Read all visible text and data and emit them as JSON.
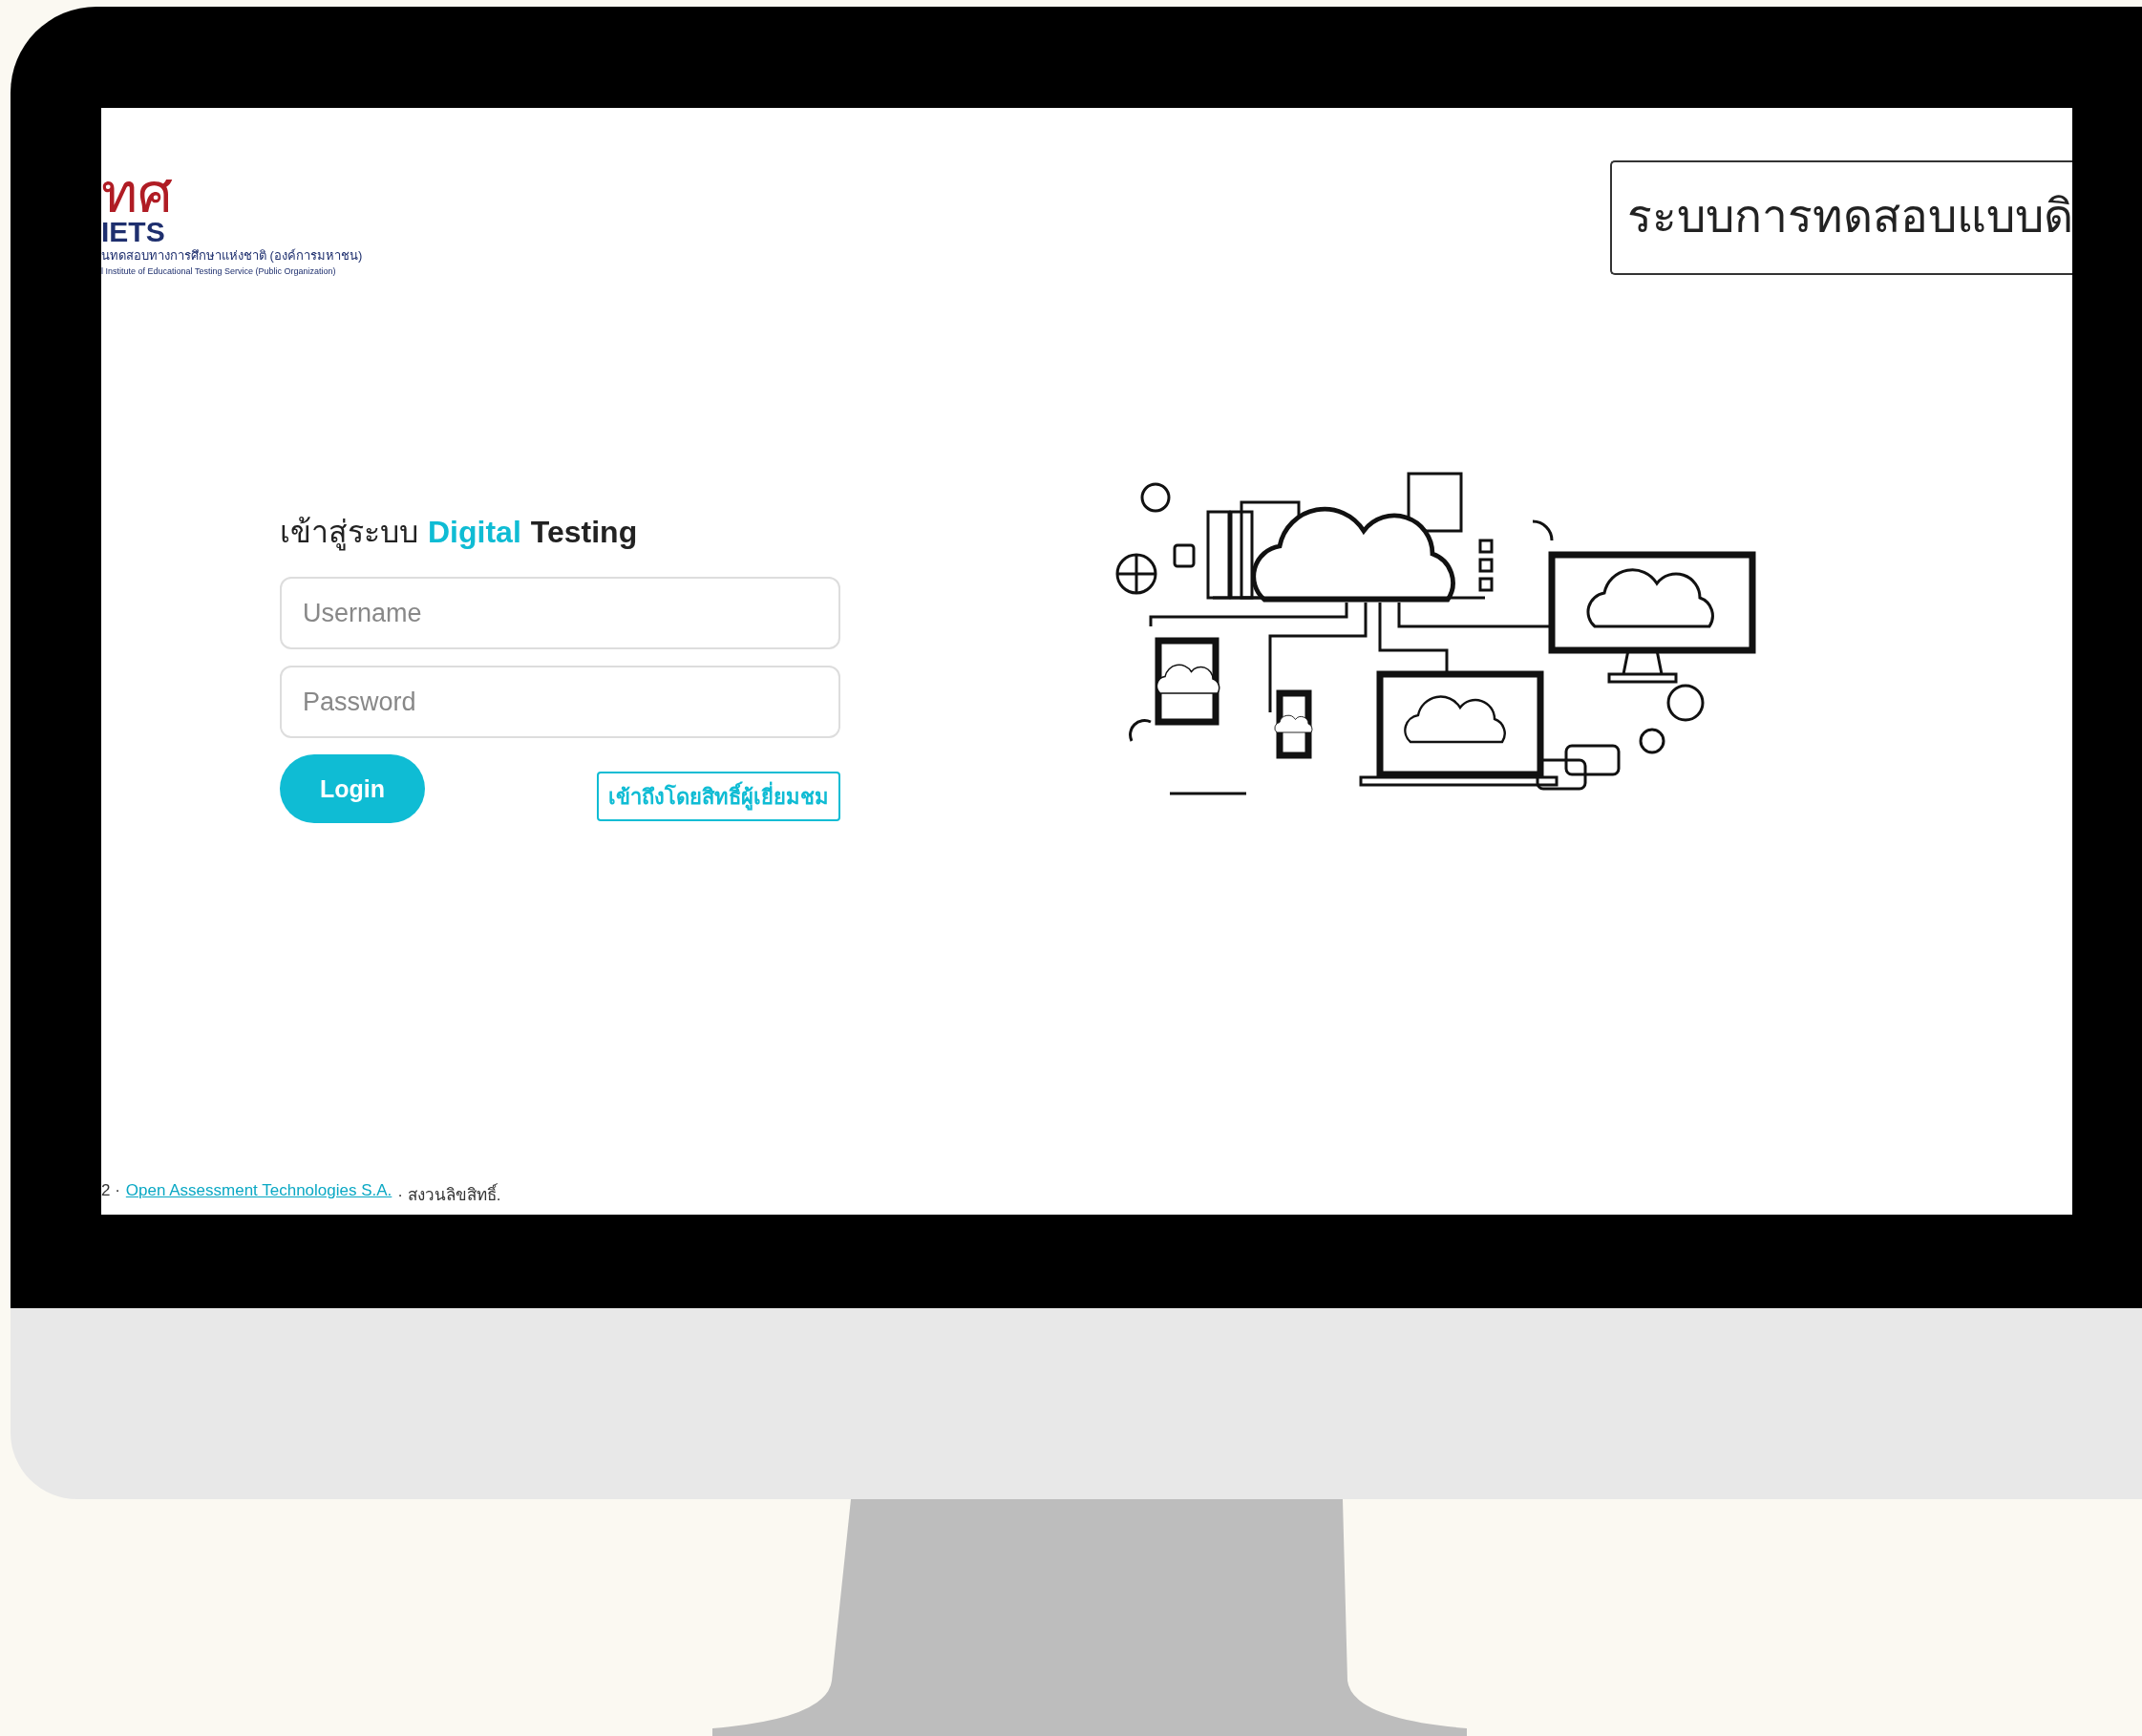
{
  "header": {
    "logo": {
      "mark": "ทศ",
      "acronym": "IETS",
      "thai_name": "นทดสอบทางการศึกษาแห่งชาติ (องค์การมหาชน)",
      "english_name": "l Institute of Educational Testing Service (Public Organization)"
    },
    "title": "ระบบการทดสอบแบบดิ"
  },
  "login": {
    "heading": {
      "prefix": "เข้าสู่ระบบ",
      "highlight": "Digital",
      "suffix": "Testing"
    },
    "username": {
      "placeholder": "Username"
    },
    "password": {
      "placeholder": "Password"
    },
    "login_button": "Login",
    "guest_button": "เข้าถึงโดยสิทธิ์ผู้เยี่ยมชม"
  },
  "footer": {
    "prefix": "2 ·",
    "link": "Open Assessment Technologies S.A.",
    "suffix": "· สงวนลิขสิทธิ์."
  }
}
